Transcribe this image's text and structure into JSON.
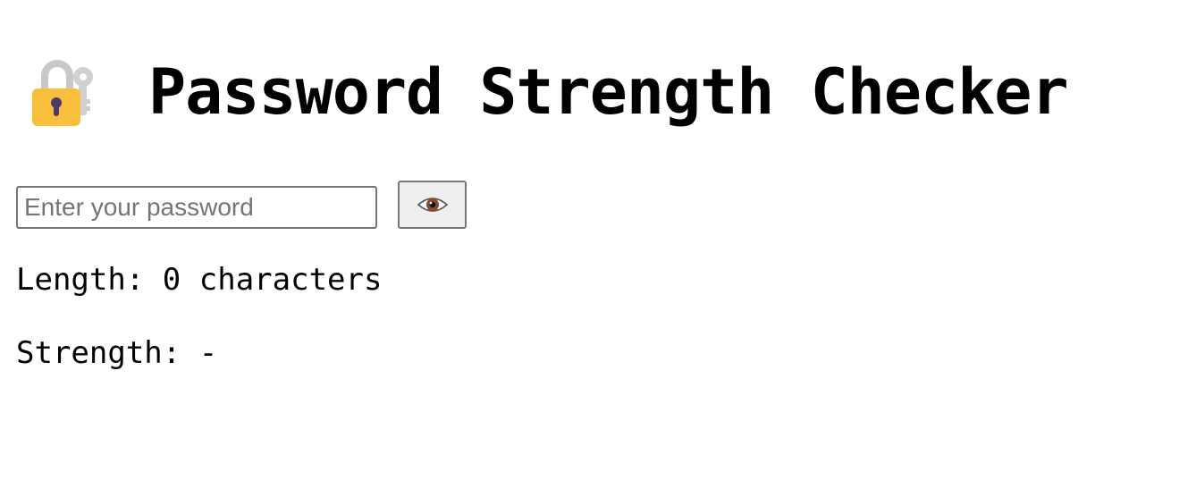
{
  "header": {
    "icon": "locked-with-key-icon",
    "title": "Password Strength Checker"
  },
  "password": {
    "value": "",
    "placeholder": "Enter your password"
  },
  "toggle": {
    "icon": "eye-icon"
  },
  "stats": {
    "length_label": "Length:",
    "length_value": "0",
    "length_unit": "characters",
    "strength_label": "Strength:",
    "strength_value": "-"
  },
  "colors": {
    "lock_body": "#F9BF3B",
    "shackle_and_key": "#C8C8C8",
    "keyhole": "#4B3A6E"
  }
}
